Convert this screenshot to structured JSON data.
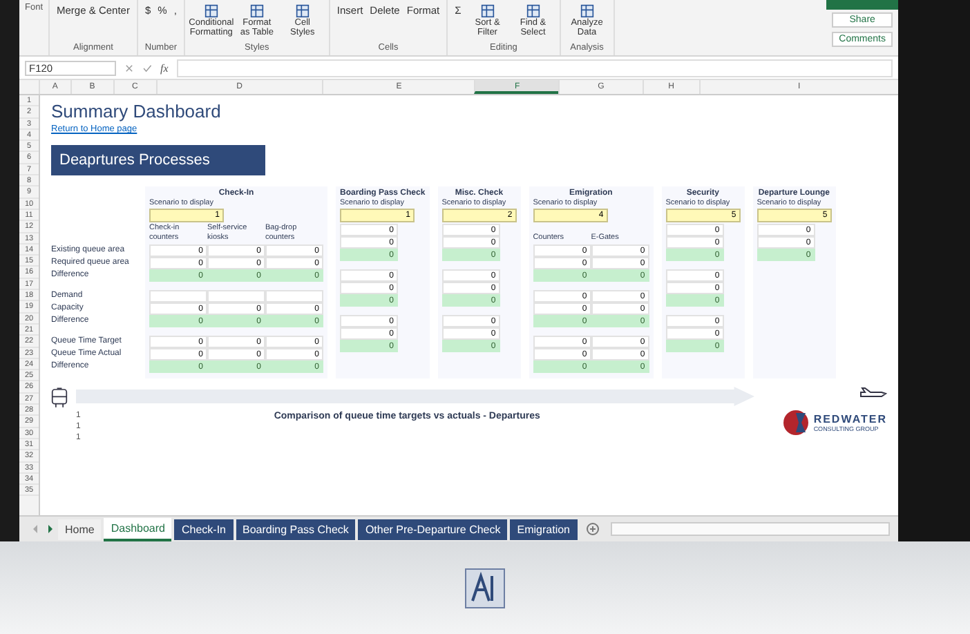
{
  "ribbon": {
    "groups": [
      {
        "label": "Font"
      },
      {
        "label": "Alignment",
        "buttons": [
          {
            "label": "Merge & Center",
            "kind": "small"
          }
        ]
      },
      {
        "label": "Number",
        "buttons": [
          {
            "label": "$",
            "kind": "small"
          },
          {
            "label": "%",
            "kind": "small"
          },
          {
            "label": ",",
            "kind": "small"
          }
        ]
      },
      {
        "label": "Styles",
        "buttons": [
          {
            "label": "Conditional Formatting",
            "kind": "large"
          },
          {
            "label": "Format as Table",
            "kind": "large"
          },
          {
            "label": "Cell Styles",
            "kind": "large"
          }
        ]
      },
      {
        "label": "Cells",
        "buttons": [
          {
            "label": "Insert",
            "kind": "small"
          },
          {
            "label": "Delete",
            "kind": "small"
          },
          {
            "label": "Format",
            "kind": "small"
          }
        ]
      },
      {
        "label": "Editing",
        "buttons": [
          {
            "label": "Σ",
            "kind": "small"
          },
          {
            "label": "Sort & Filter",
            "kind": "large"
          },
          {
            "label": "Find & Select",
            "kind": "large"
          }
        ]
      },
      {
        "label": "Analysis",
        "buttons": [
          {
            "label": "Analyze Data",
            "kind": "large"
          }
        ]
      }
    ],
    "share_button": "Share",
    "comments_button": "Comments"
  },
  "formula_bar": {
    "name_box": "F120",
    "function_label": "fx"
  },
  "columns": [
    {
      "label": "A",
      "selected": false
    },
    {
      "label": "B",
      "selected": false
    },
    {
      "label": "C",
      "selected": false
    },
    {
      "label": "D",
      "selected": false
    },
    {
      "label": "E",
      "selected": false
    },
    {
      "label": "F",
      "selected": true
    },
    {
      "label": "G",
      "selected": false
    },
    {
      "label": "H",
      "selected": false
    },
    {
      "label": "I",
      "selected": false
    }
  ],
  "row_numbers": [
    "1",
    "2",
    "3",
    "4",
    "5",
    "6",
    "7",
    "8",
    "9",
    "10",
    "11",
    "12",
    "13",
    "14",
    "15",
    "16",
    "17",
    "18",
    "19",
    "20",
    "21",
    "22",
    "23",
    "24",
    "25",
    "26",
    "27",
    "28",
    "29",
    "30",
    "31",
    "32",
    "33",
    "34",
    "35"
  ],
  "dashboard": {
    "title": "Summary Dashboard",
    "home_link": "Return to Home page",
    "banner": "Deaprtures Processes",
    "row_label_groups": [
      [
        "Existing queue area",
        "Required queue area",
        "Difference"
      ],
      [
        "Demand",
        "Capacity",
        "Difference"
      ],
      [
        "Queue Time Target",
        "Queue Time Actual",
        "Difference"
      ]
    ],
    "sections": [
      {
        "title": "Check-In",
        "scenario_label": "Scenario to display",
        "scenario_value": "1",
        "subheaders": [
          "Check-in counters",
          "Self-service kiosks",
          "Bag-drop counters"
        ],
        "groups": [
          [
            {
              "kind": "input",
              "cells": [
                "0",
                "0",
                "0"
              ]
            },
            {
              "kind": "input",
              "cells": [
                "0",
                "0",
                "0"
              ]
            },
            {
              "kind": "difference",
              "cells": [
                "0",
                "0",
                "0"
              ]
            }
          ],
          [
            {
              "kind": "input",
              "cells": [
                null,
                null,
                null
              ]
            },
            {
              "kind": "input",
              "cells": [
                "0",
                "0",
                "0"
              ]
            },
            {
              "kind": "difference",
              "cells": [
                "0",
                "0",
                "0"
              ]
            }
          ],
          [
            {
              "kind": "input",
              "cells": [
                "0",
                "0",
                "0"
              ]
            },
            {
              "kind": "input",
              "cells": [
                "0",
                "0",
                "0"
              ]
            },
            {
              "kind": "difference",
              "cells": [
                "0",
                "0",
                "0"
              ]
            }
          ]
        ]
      },
      {
        "title": "Boarding Pass Check",
        "scenario_label": "Scenario to display",
        "scenario_value": "1",
        "groups": [
          [
            {
              "kind": "input",
              "cells": [
                "0"
              ]
            },
            {
              "kind": "input",
              "cells": [
                "0"
              ]
            },
            {
              "kind": "difference",
              "cells": [
                "0"
              ]
            }
          ],
          [
            {
              "kind": "input",
              "cells": [
                "0"
              ]
            },
            {
              "kind": "input",
              "cells": [
                "0"
              ]
            },
            {
              "kind": "difference",
              "cells": [
                "0"
              ]
            }
          ],
          [
            {
              "kind": "input",
              "cells": [
                "0"
              ]
            },
            {
              "kind": "input",
              "cells": [
                "0"
              ]
            },
            {
              "kind": "difference",
              "cells": [
                "0"
              ]
            }
          ]
        ]
      },
      {
        "title": "Misc. Check",
        "scenario_label": "Scenario to display",
        "scenario_value": "2",
        "groups": [
          [
            {
              "kind": "input",
              "cells": [
                "0"
              ]
            },
            {
              "kind": "input",
              "cells": [
                "0"
              ]
            },
            {
              "kind": "difference",
              "cells": [
                "0"
              ]
            }
          ],
          [
            {
              "kind": "input",
              "cells": [
                "0"
              ]
            },
            {
              "kind": "input",
              "cells": [
                "0"
              ]
            },
            {
              "kind": "difference",
              "cells": [
                "0"
              ]
            }
          ],
          [
            {
              "kind": "input",
              "cells": [
                "0"
              ]
            },
            {
              "kind": "input",
              "cells": [
                "0"
              ]
            },
            {
              "kind": "difference",
              "cells": [
                "0"
              ]
            }
          ]
        ]
      },
      {
        "title": "Emigration",
        "scenario_label": "Scenario to display",
        "scenario_value": "4",
        "subheaders": [
          "Counters",
          "E-Gates"
        ],
        "groups": [
          [
            {
              "kind": "input",
              "cells": [
                "0",
                "0"
              ]
            },
            {
              "kind": "input",
              "cells": [
                "0",
                "0"
              ]
            },
            {
              "kind": "difference",
              "cells": [
                "0",
                "0"
              ]
            }
          ],
          [
            {
              "kind": "input",
              "cells": [
                "0",
                "0"
              ]
            },
            {
              "kind": "input",
              "cells": [
                "0",
                "0"
              ]
            },
            {
              "kind": "difference",
              "cells": [
                "0",
                "0"
              ]
            }
          ],
          [
            {
              "kind": "input",
              "cells": [
                "0",
                "0"
              ]
            },
            {
              "kind": "input",
              "cells": [
                "0",
                "0"
              ]
            },
            {
              "kind": "difference",
              "cells": [
                "0",
                "0"
              ]
            }
          ]
        ]
      },
      {
        "title": "Security",
        "scenario_label": "Scenario to display",
        "scenario_value": "5",
        "groups": [
          [
            {
              "kind": "input",
              "cells": [
                "0"
              ]
            },
            {
              "kind": "input",
              "cells": [
                "0"
              ]
            },
            {
              "kind": "difference",
              "cells": [
                "0"
              ]
            }
          ],
          [
            {
              "kind": "input",
              "cells": [
                "0"
              ]
            },
            {
              "kind": "input",
              "cells": [
                "0"
              ]
            },
            {
              "kind": "difference",
              "cells": [
                "0"
              ]
            }
          ],
          [
            {
              "kind": "input",
              "cells": [
                "0"
              ]
            },
            {
              "kind": "input",
              "cells": [
                "0"
              ]
            },
            {
              "kind": "difference",
              "cells": [
                "0"
              ]
            }
          ]
        ]
      },
      {
        "title": "Departure Lounge",
        "scenario_label": "Scenario to display",
        "scenario_value": "5",
        "groups": [
          [
            {
              "kind": "input",
              "cells": [
                "0"
              ]
            },
            {
              "kind": "input",
              "cells": [
                "0"
              ]
            },
            {
              "kind": "difference",
              "cells": [
                "0"
              ]
            }
          ]
        ]
      }
    ],
    "chart": {
      "title": "Comparison of queue time targets vs actuals - Departures",
      "axis_labels": [
        "1",
        "1",
        "1"
      ]
    },
    "logo": {
      "name": "REDWATER",
      "tagline": "CONSULTING GROUP"
    }
  },
  "sheet_tabs": [
    {
      "label": "Home",
      "selected": false,
      "kind": "plain"
    },
    {
      "label": "Dashboard",
      "selected": true
    },
    {
      "label": "Check-In",
      "selected": false,
      "kind": "colored"
    },
    {
      "label": "Boarding Pass Check",
      "selected": false,
      "kind": "colored"
    },
    {
      "label": "Other Pre-Departure Check",
      "selected": false,
      "kind": "colored"
    },
    {
      "label": "Emigration",
      "selected": false,
      "kind": "colored"
    }
  ]
}
